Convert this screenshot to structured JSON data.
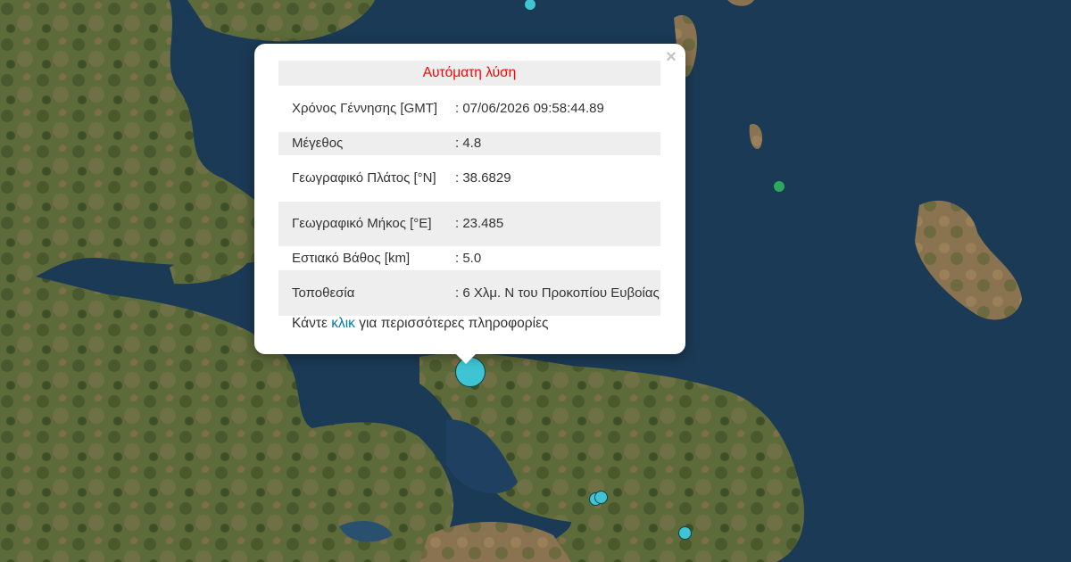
{
  "popup": {
    "title": "Αυτόματη λύση",
    "rows": [
      {
        "label": "Χρόνος Γέννησης [GMT]",
        "value": ": 07/06/2026 09:58:44.89"
      },
      {
        "label": "Μέγεθος",
        "value": ": 4.8"
      },
      {
        "label": "Γεωγραφικό Πλάτος [°N]",
        "value": ": 38.6829"
      },
      {
        "label": "Γεωγραφικό Μήκος [°E]",
        "value": ": 23.485"
      },
      {
        "label": "Εστιακό Βάθος [km]",
        "value": ": 5.0"
      },
      {
        "label": "Τοποθεσία",
        "value": ": 6 Χλμ. Ν του Προκοπίου Ευβοίας"
      }
    ],
    "more_prefix": "Κάντε",
    "more_link": "κλικ",
    "more_suffix": "για περισσότερες πληροφορίες",
    "close_symbol": "×"
  },
  "colors": {
    "title": "#ff0000",
    "link": "#0078a8",
    "marker_cyan": "#3fc4d4",
    "marker_green": "#2ea85f",
    "sea": "#1b3a55"
  }
}
